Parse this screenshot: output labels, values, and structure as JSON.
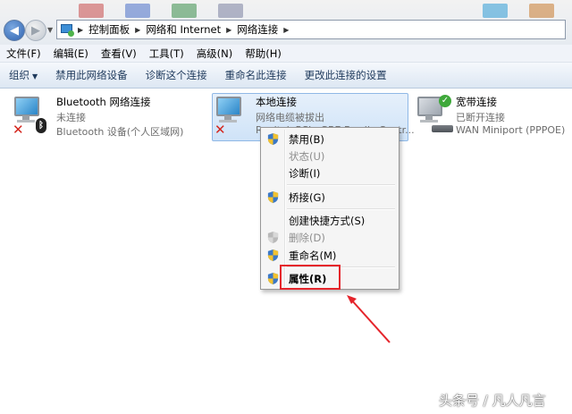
{
  "address": {
    "crumbs": [
      "控制面板",
      "网络和 Internet",
      "网络连接"
    ]
  },
  "menubar": [
    "文件(F)",
    "编辑(E)",
    "查看(V)",
    "工具(T)",
    "高级(N)",
    "帮助(H)"
  ],
  "commandbar": {
    "organize": "组织",
    "commands": [
      "禁用此网络设备",
      "诊断这个连接",
      "重命名此连接",
      "更改此连接的设置"
    ]
  },
  "connections": [
    {
      "name": "Bluetooth 网络连接",
      "status": "未连接",
      "device": "Bluetooth 设备(个人区域网)",
      "icon": "bluetooth-network-icon",
      "state_icon": "red-x-icon"
    },
    {
      "name": "本地连接",
      "status": "网络电缆被拔出",
      "device": "Realtek PCIe GBE Family Contr...",
      "icon": "ethernet-network-icon",
      "state_icon": "red-x-icon",
      "selected": true
    },
    {
      "name": "宽带连接",
      "status": "已断开连接",
      "device": "WAN Miniport (PPPOE)",
      "icon": "broadband-network-icon",
      "state_icon": "green-check-icon"
    }
  ],
  "context_menu": [
    {
      "label": "禁用(B)",
      "shield": true,
      "disabled": false
    },
    {
      "label": "状态(U)",
      "shield": false,
      "disabled": true
    },
    {
      "label": "诊断(I)",
      "shield": false,
      "disabled": false
    },
    {
      "label": "桥接(G)",
      "shield": true,
      "disabled": false
    },
    {
      "label": "创建快捷方式(S)",
      "shield": false,
      "disabled": false
    },
    {
      "label": "删除(D)",
      "shield": true,
      "disabled": true
    },
    {
      "label": "重命名(M)",
      "shield": true,
      "disabled": false
    },
    {
      "label": "属性(R)",
      "shield": true,
      "disabled": false,
      "bold": true
    }
  ],
  "watermark": "头条号 / 凡人凡言",
  "colors": {
    "annotation_red": "#e5242b",
    "accent_blue": "#2f63b0"
  }
}
